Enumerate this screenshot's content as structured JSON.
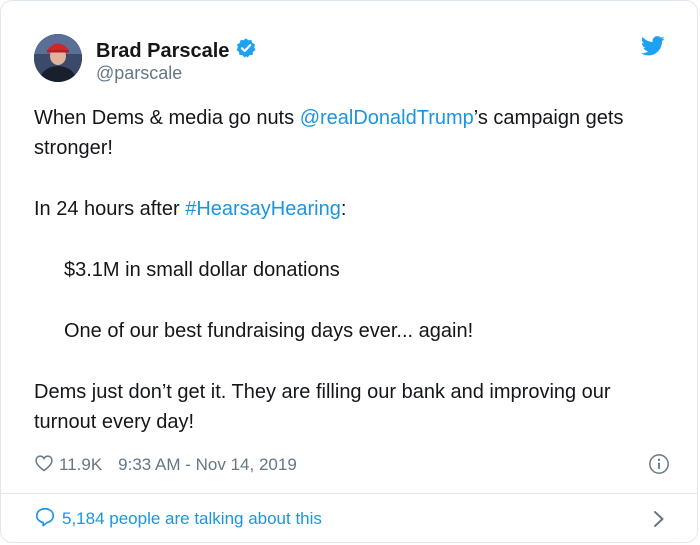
{
  "tweet": {
    "author_name": "Brad Parscale",
    "author_handle": "@parscale",
    "para1_before": "When Dems & media go nuts ",
    "para1_mention": "@realDonaldTrump",
    "para1_after": "’s campaign gets stronger!",
    "para2_before": "In 24 hours after ",
    "para2_hashtag": "#HearsayHearing",
    "para2_after": ":",
    "para3": "$3.1M in small dollar donations",
    "para4": "One of our best fundraising days ever... again!",
    "para5": "Dems just don’t get it. They are filling our bank and improving our turnout every day!",
    "like_count": "11.9K",
    "timestamp": "9:33 AM - Nov 14, 2019",
    "talking_text": "5,184 people are talking about this"
  },
  "icons": {
    "verified": "verified-badge-icon",
    "bird": "twitter-bird-icon",
    "like": "heart-icon",
    "info": "info-icon",
    "reply": "speech-bubble-icon",
    "chevron": "chevron-right-icon"
  },
  "colors": {
    "link": "#1b95e0",
    "text": "#14171a",
    "muted": "#657786",
    "border": "#e1e8ed"
  }
}
